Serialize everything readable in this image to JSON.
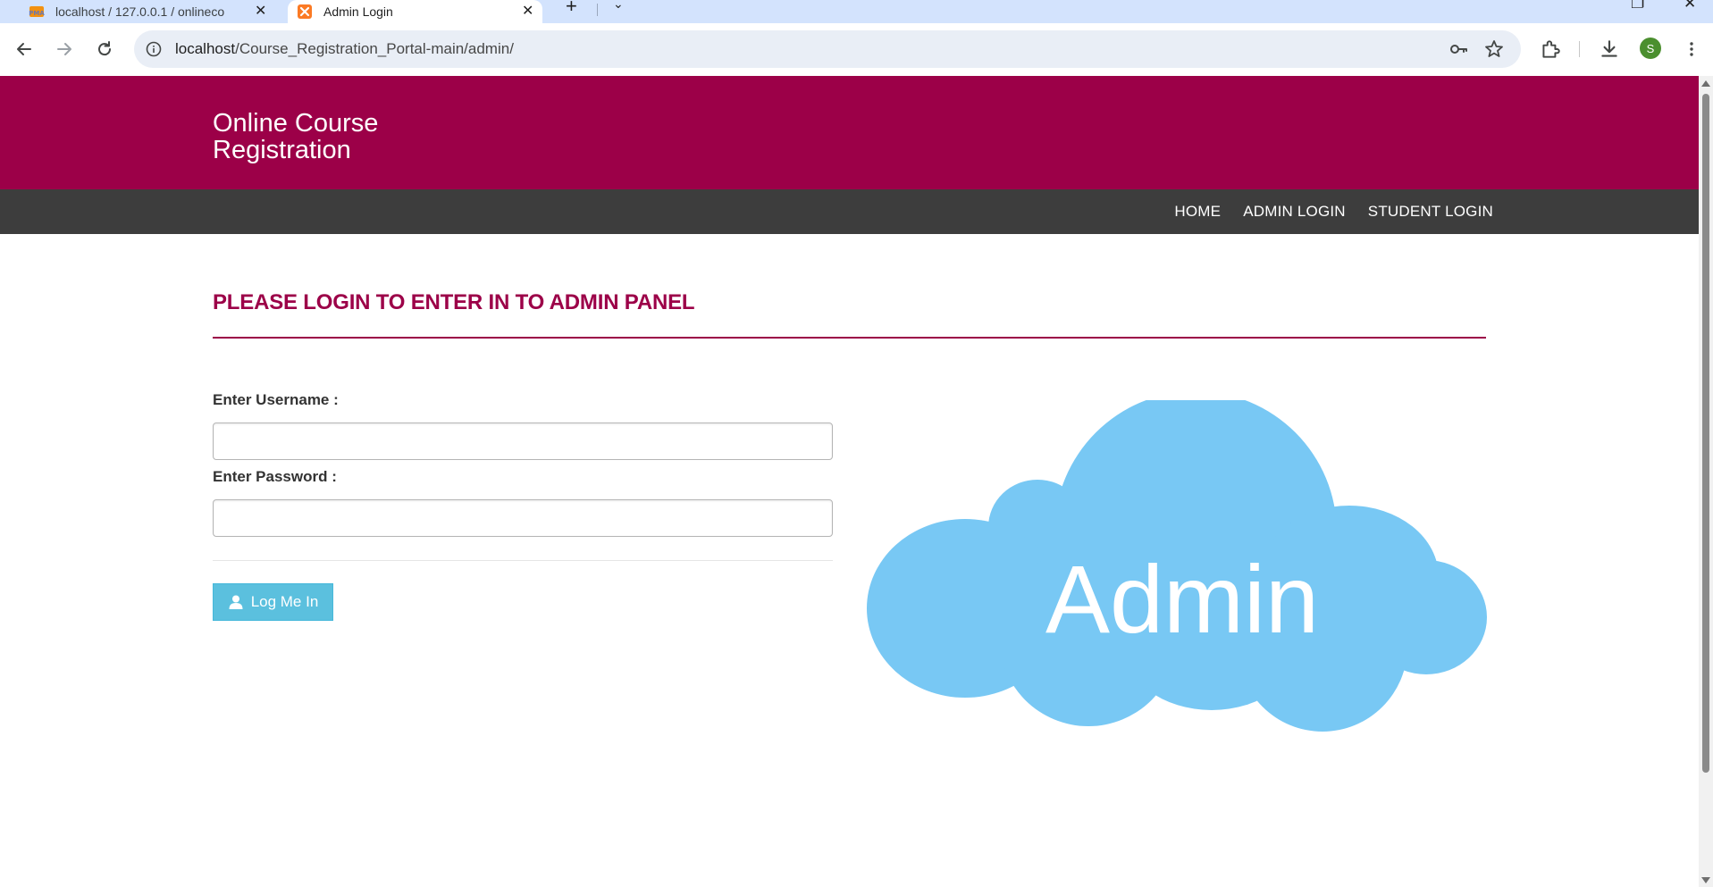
{
  "browser": {
    "tabs": [
      {
        "title": "localhost / 127.0.0.1 / onlineco",
        "favicon": "phpmyadmin-icon",
        "active": false
      },
      {
        "title": "Admin Login",
        "favicon": "xampp-icon",
        "active": true
      }
    ],
    "url_host": "localhost",
    "url_path": "/Course_Registration_Portal-main/admin/",
    "profile_initial": "S",
    "profile_color": "#4b8f2f"
  },
  "site": {
    "brand": "Online Course Registration",
    "header_color": "#9c0048",
    "navbar_color": "#3d3d3d",
    "nav": [
      "HOME",
      "ADMIN LOGIN",
      "STUDENT LOGIN"
    ]
  },
  "main": {
    "heading": "PLEASE LOGIN TO ENTER IN TO ADMIN PANEL",
    "username_label": "Enter Username :",
    "username_value": "",
    "password_label": "Enter Password :",
    "password_value": "",
    "login_button": "Log Me In",
    "cloud_text": "Admin",
    "cloud_color": "#78c8f4",
    "button_color": "#5bc0de"
  }
}
